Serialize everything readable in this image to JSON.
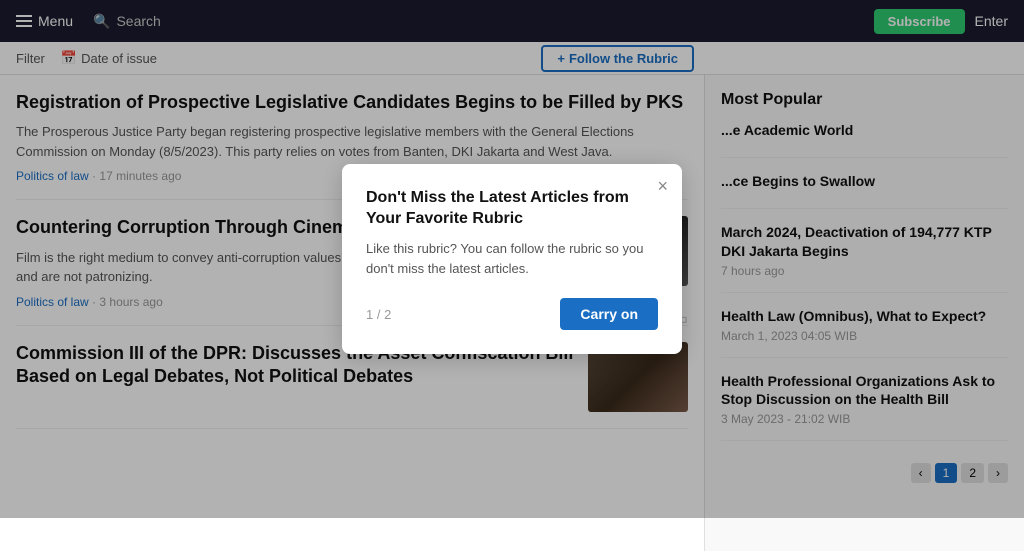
{
  "header": {
    "menu_label": "Menu",
    "search_label": "Search",
    "subscribe_label": "Subscribe",
    "enter_label": "Enter"
  },
  "toolbar": {
    "filter_label": "Filter",
    "date_label": "Date of issue",
    "follow_rubric_label": "Follow the Rubric",
    "plus_icon": "+"
  },
  "articles": [
    {
      "title": "Registration of Prospective Legislative Candidates Begins to be Filled by PKS",
      "excerpt": "The Prosperous Justice Party began registering prospective legislative members with the General Elections Commission on Monday (8/5/2023). This party relies on votes from Banten, DKI Jakarta and West Java.",
      "category": "Politics of law",
      "time": "17 minutes ago",
      "has_thumb": false
    },
    {
      "title": "Countering Corruption Through Cinema",
      "excerpt": "Film is the right medium to convey anti-corruption values. Films can be accepted by all groups and are not patronizing.",
      "category": "Politics of law",
      "time": "3 hours ago",
      "has_thumb": true,
      "thumb_class": "article-thumb-cinema"
    },
    {
      "title": "Commission III of the DPR: Discusses the Asset Confiscation Bill Based on Legal Debates, Not Political Debates",
      "excerpt": "",
      "category": "",
      "time": "",
      "has_thumb": true,
      "thumb_class": "article-thumb-dpr"
    }
  ],
  "sidebar": {
    "most_popular_title": "Most Popular",
    "items": [
      {
        "title": "...e Academic World",
        "meta": "",
        "type": "title-only"
      },
      {
        "title": "...ce Begins to Swallow",
        "meta": "",
        "type": "title-only"
      },
      {
        "title": "March 2024, Deactivation of 194,777 KTP DKI Jakarta Begins",
        "meta": "7 hours ago",
        "type": "full"
      },
      {
        "title": "Health Law (Omnibus), What to Expect?",
        "meta": "March 1, 2023 04:05 WIB",
        "type": "full"
      },
      {
        "title": "Health Professional Organizations Ask to Stop Discussion on the Health Bill",
        "meta": "3 May 2023 - 21:02 WIB",
        "type": "full"
      }
    ]
  },
  "modal": {
    "title": "Don't Miss the Latest Articles from Your Favorite Rubric",
    "body": "Like this rubric? You can follow the rubric so you don't miss the latest articles.",
    "pagination": "1 / 2",
    "carry_on_label": "Carry on",
    "close_icon": "×"
  }
}
